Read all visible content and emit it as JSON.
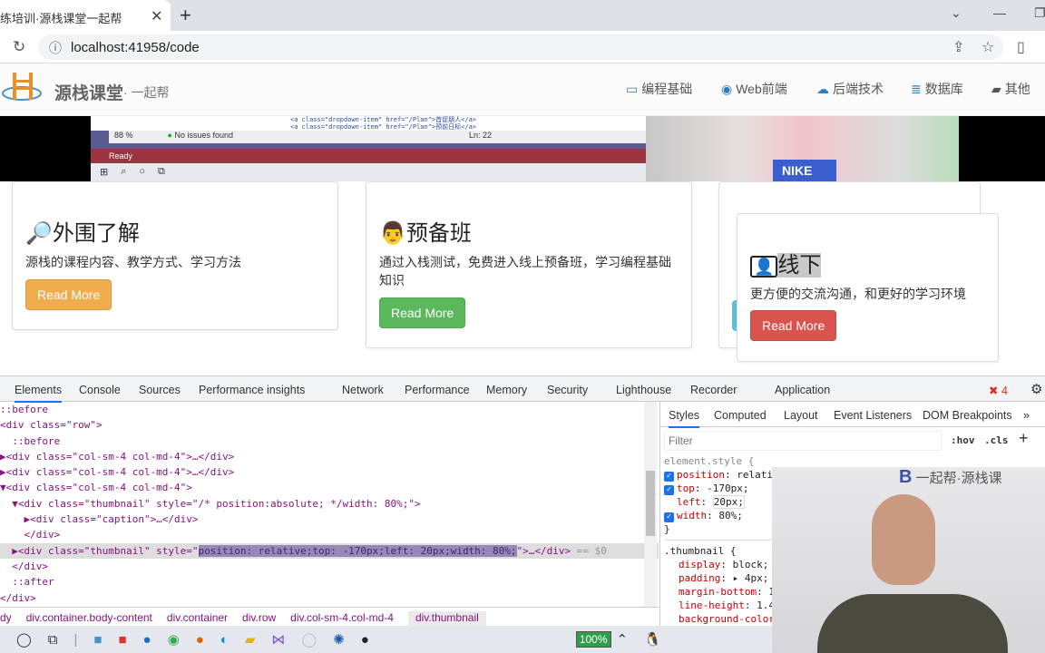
{
  "browser": {
    "tab_title": "练培训·源栈课堂一起帮",
    "url": "localhost:41958/code"
  },
  "site": {
    "brand": "源栈课堂",
    "brand_sub": "· 一起帮",
    "nav": [
      {
        "icon": "laptop-icon",
        "label": "编程基础"
      },
      {
        "icon": "chrome-icon",
        "label": "Web前端"
      },
      {
        "icon": "cloud-icon",
        "label": "后端技术"
      },
      {
        "icon": "database-icon",
        "label": "数据库"
      },
      {
        "icon": "book-icon",
        "label": "其他"
      }
    ]
  },
  "video": {
    "code1": "<a class=\"dropdown-item\" href=\"/Plan\">首促朋人</a>",
    "code2": "<a class=\"dropdown-item\" href=\"/Plan\">预前日标</a>",
    "zoom": "88 %",
    "issues": "No issues found",
    "pos": "Ln: 22",
    "ready": "Ready",
    "shirt": "NIKE"
  },
  "cards": [
    {
      "title": "外围了解",
      "text": "源栈的课程内容、教学方式、学习方法",
      "button": "Read More",
      "color": "#f0ad4e"
    },
    {
      "title": "预备班",
      "text": "通过入栈测试，免费进入线上预备班，学习编程基础知识",
      "button": "Read More",
      "color": "#5cb85c"
    },
    {
      "title": "线下",
      "text": "更方便的交流沟通，和更好的学习环境",
      "button": "Read More",
      "color": "#d9534f"
    }
  ],
  "devtools": {
    "tabs": [
      "Elements",
      "Console",
      "Sources",
      "Performance insights",
      "Network",
      "Performance",
      "Memory",
      "Security",
      "Lighthouse",
      "Recorder",
      "Application"
    ],
    "error_count": "4",
    "dom": [
      "::before",
      "<div class=\"row\">",
      "  ::before",
      "▶<div class=\"col-sm-4 col-md-4\">…</div>",
      "▶<div class=\"col-sm-4 col-md-4\">…</div>",
      "▼<div class=\"col-sm-4 col-md-4\">",
      "  ▼<div class=\"thumbnail\" style=\"/* position:absolute; */width: 80%;\">",
      "    ▶<div class=\"caption\">…</div>",
      "    </div>"
    ],
    "selected": {
      "pre": "  ▶<div class=\"thumbnail\" style=\"",
      "hl": "position: relative;top: -170px;left: 20px;width: 80%;",
      "post": "\">…</div>",
      "ref": " == $0"
    },
    "dom_after": [
      "  </div>",
      "  ::after",
      "</div>"
    ],
    "breadcrumbs": [
      "dy",
      "div.container.body-content",
      "div.container",
      "div.row",
      "div.col-sm-4.col-md-4",
      "div.thumbnail"
    ],
    "styles_tabs": [
      "Styles",
      "Computed",
      "Layout",
      "Event Listeners",
      "DOM Breakpoints",
      "»"
    ],
    "filter_placeholder": "Filter",
    "hov": ":hov",
    "cls": ".cls",
    "element_style": "element.style {",
    "props": [
      {
        "checked": true,
        "name": "position",
        "value": "relati"
      },
      {
        "checked": true,
        "name": "top",
        "value": "-170px;"
      },
      {
        "checked": false,
        "name": "left",
        "value": "20px;"
      },
      {
        "checked": true,
        "name": "width",
        "value": "80%;"
      }
    ],
    "thumb_rule": ".thumbnail {",
    "thumb_props": [
      {
        "name": "display",
        "value": "block;"
      },
      {
        "name": "padding",
        "value": "▸ 4px;"
      },
      {
        "name": "margin-bottom",
        "value": "1"
      },
      {
        "name": "line-height",
        "value": "1.4"
      },
      {
        "name": "background-color",
        "value": ""
      }
    ]
  },
  "taskbar": {
    "battery": "100%"
  },
  "webcam": {
    "logo": "一起帮·源栈课"
  }
}
